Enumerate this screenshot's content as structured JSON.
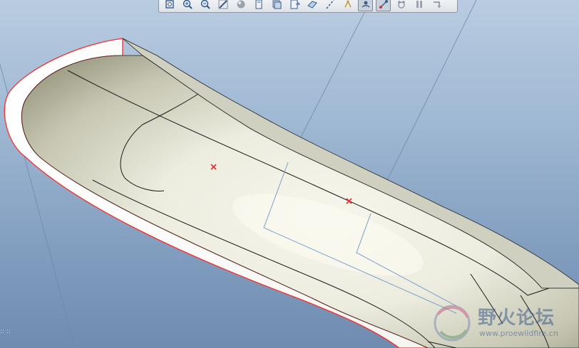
{
  "toolbar": {
    "buttons": [
      {
        "name": "refit-icon",
        "active": false
      },
      {
        "name": "zoom-in-icon",
        "active": false
      },
      {
        "name": "zoom-out-icon",
        "active": false
      },
      {
        "name": "repaint-icon",
        "active": false
      },
      {
        "name": "display-style-icon",
        "active": false
      },
      {
        "name": "saved-views-icon",
        "active": false
      },
      {
        "name": "layers-icon",
        "active": false
      },
      {
        "name": "view-manager-icon",
        "active": false
      },
      {
        "name": "datum-planes-icon",
        "active": false
      },
      {
        "name": "datum-axes-icon",
        "active": false
      },
      {
        "name": "datum-points-icon",
        "active": false
      },
      {
        "name": "coordinate-systems-icon",
        "active": true
      },
      {
        "name": "annotation-display-icon",
        "active": true
      },
      {
        "name": "spin-center-icon",
        "active": false
      },
      {
        "name": "pause-icon",
        "active": false
      },
      {
        "name": "next-icon",
        "active": false
      }
    ]
  },
  "model": {
    "edge_color": "#ff2a2a",
    "surface_color": "#e8e8dc",
    "datum_color": "#7aa0c8"
  },
  "watermark": {
    "title": "野火论坛",
    "url": "www.proewildfire.cn"
  }
}
